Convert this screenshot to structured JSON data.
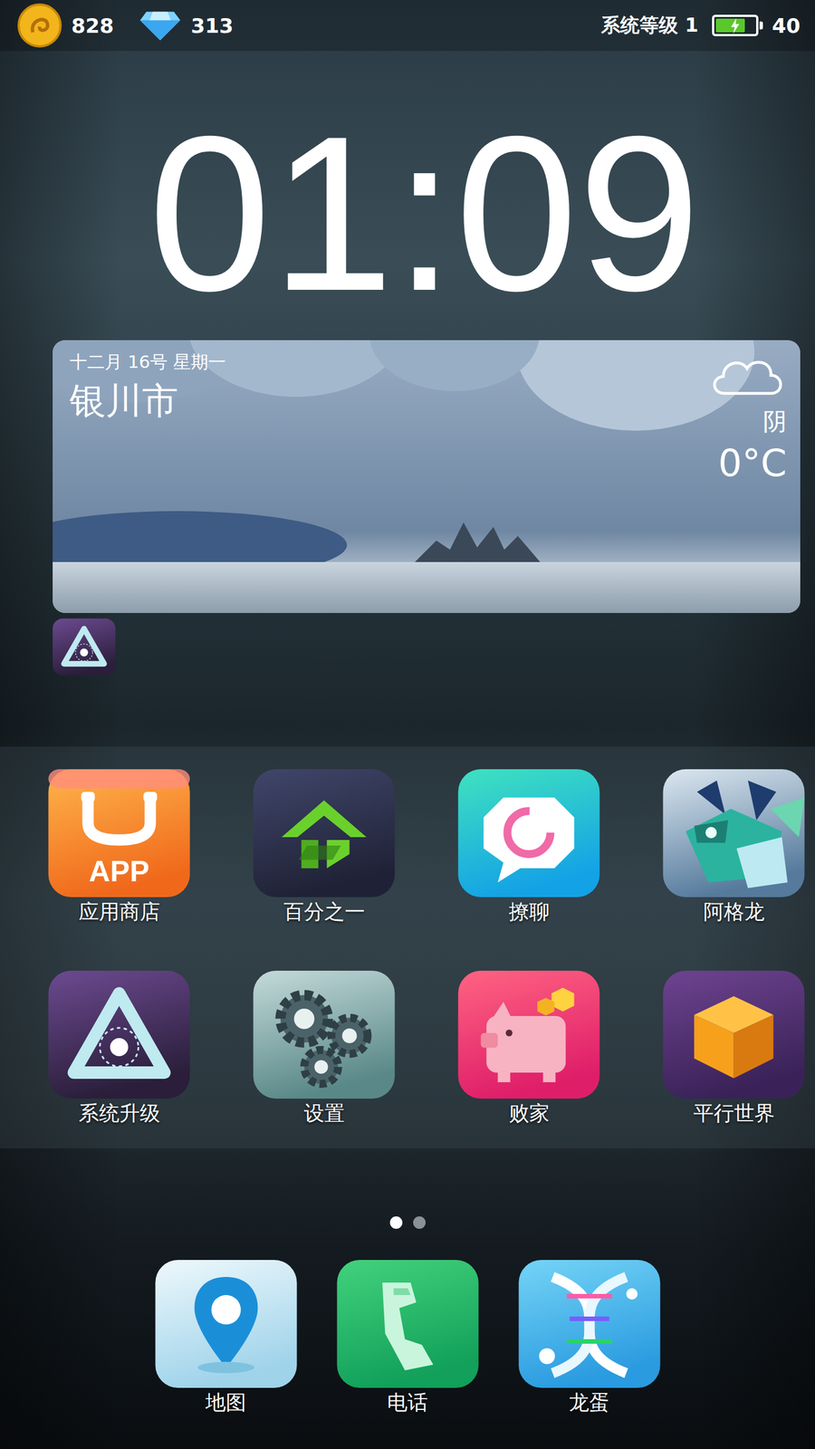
{
  "status_bar": {
    "coins": "828",
    "gems": "313",
    "level_label": "系统等级 1",
    "battery": {
      "level": 0.75,
      "charging": true
    },
    "energy": "40"
  },
  "clock": "01:09",
  "weather": {
    "date": "十二月 16号 星期一",
    "city": "银川市",
    "condition": "阴",
    "temperature": "0°C"
  },
  "apps": [
    {
      "name": "应用商店",
      "icon_text": "APP"
    },
    {
      "name": "百分之一"
    },
    {
      "name": "撩聊"
    },
    {
      "name": "阿格龙"
    },
    {
      "name": "系统升级"
    },
    {
      "name": "设置"
    },
    {
      "name": "败家"
    },
    {
      "name": "平行世界"
    }
  ],
  "pages": [
    {
      "selected": true
    },
    {
      "selected": false
    }
  ],
  "dock": [
    {
      "name": "地图"
    },
    {
      "name": "电话"
    },
    {
      "name": "龙蛋"
    }
  ]
}
